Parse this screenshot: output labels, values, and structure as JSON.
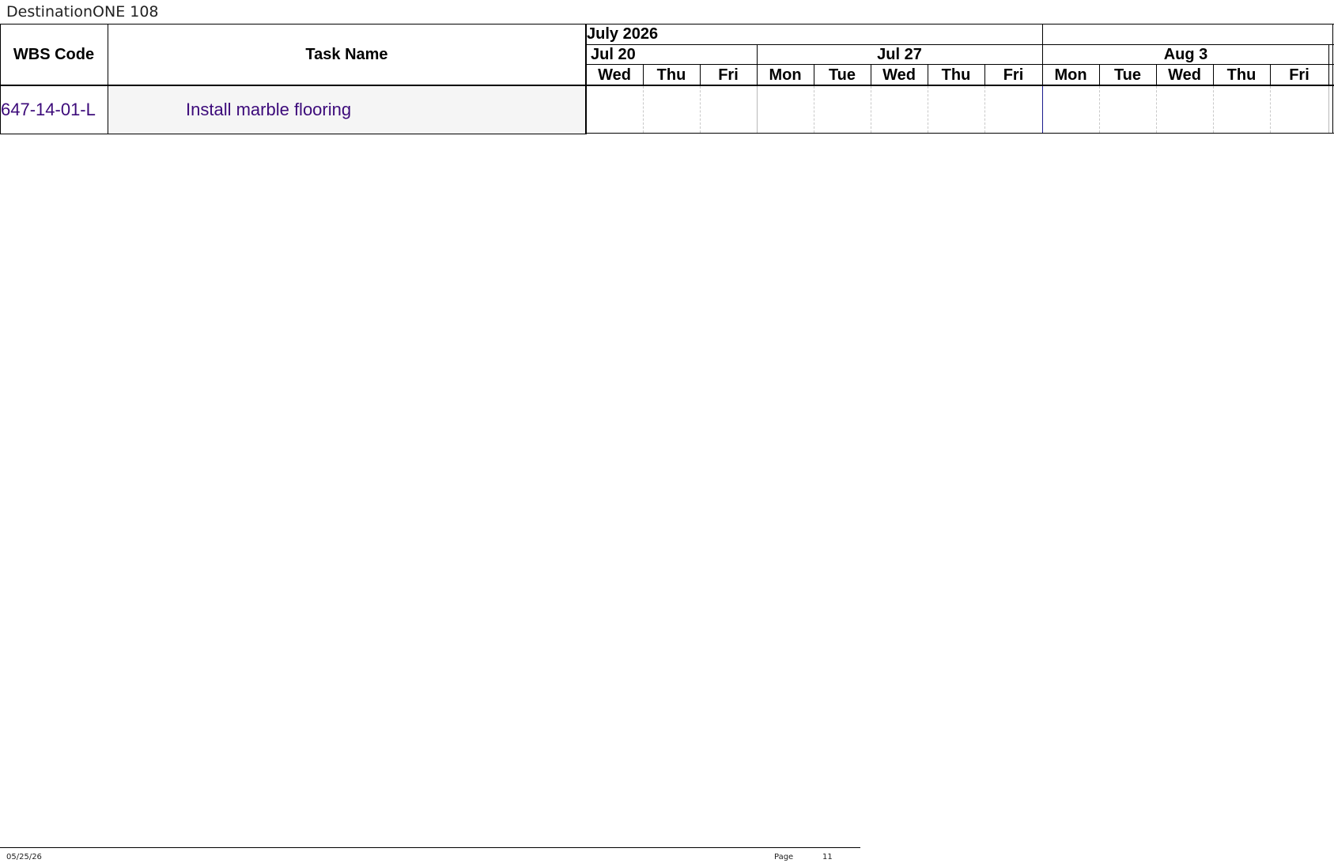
{
  "document": {
    "title": "DestinationONE 108"
  },
  "table": {
    "columns": {
      "wbs": "WBS Code",
      "task": "Task Name"
    },
    "timescale": {
      "month_label": "July 2026",
      "weeks": [
        "Jul 20",
        "Jul 27",
        "Aug 3"
      ],
      "days": [
        "Wed",
        "Thu",
        "Fri",
        "Mon",
        "Tue",
        "Wed",
        "Thu",
        "Fri",
        "Mon",
        "Tue",
        "Wed",
        "Thu",
        "Fri"
      ]
    },
    "rows": [
      {
        "wbs_code": "647-14-01-L",
        "task_name": "Install marble flooring"
      }
    ]
  },
  "footer": {
    "date": "05/25/26",
    "page_label": "Page",
    "page_number": "11"
  },
  "colors": {
    "task_text": "#3c0a7a",
    "row_background": "#f5f5f5",
    "week_separator": "#1a1a8c"
  }
}
